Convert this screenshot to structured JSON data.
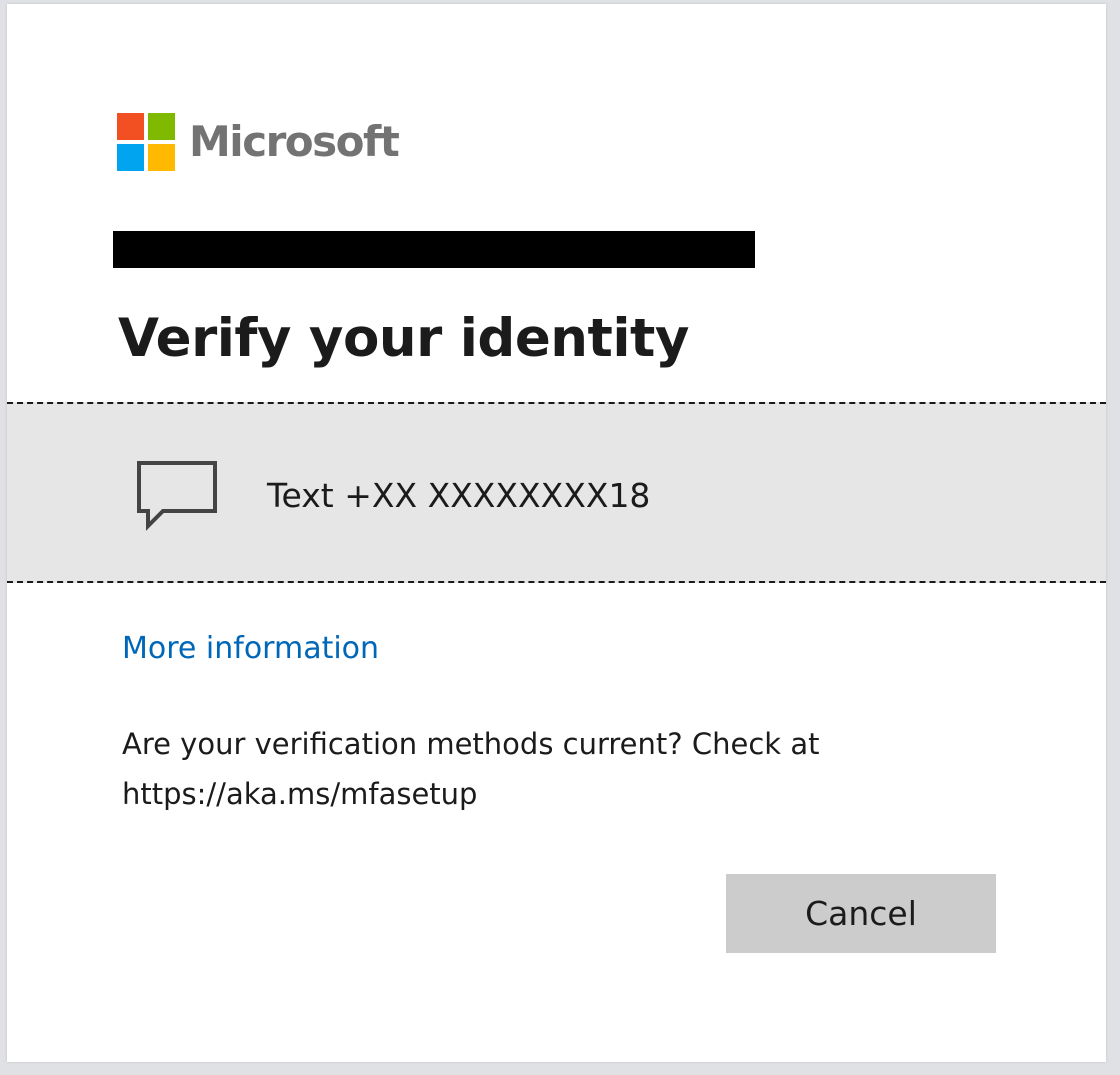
{
  "brand": {
    "name": "Microsoft",
    "logo_colors": [
      "#f25022",
      "#7fba00",
      "#00a4ef",
      "#ffb900"
    ]
  },
  "page": {
    "title": "Verify your identity"
  },
  "method": {
    "icon": "chat-bubble-icon",
    "label": "Text +XX XXXXXXXX18"
  },
  "links": {
    "more_info": "More information"
  },
  "notice": {
    "text": "Are your verification methods current? Check at https://aka.ms/mfasetup"
  },
  "actions": {
    "cancel_label": "Cancel"
  },
  "colors": {
    "link": "#0067b8",
    "button_bg": "#cccccc",
    "method_bg": "#e6e6e6"
  }
}
